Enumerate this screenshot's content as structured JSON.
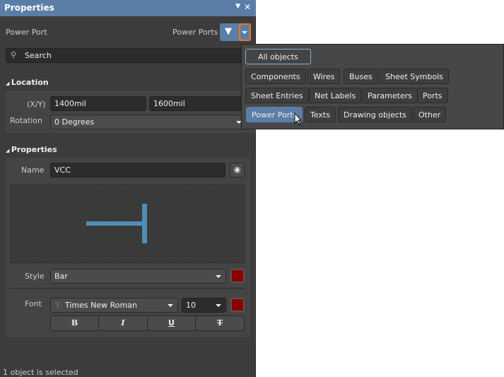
{
  "title": "Properties",
  "header": {
    "object_type": "Power Port",
    "filter_label": "Power Ports"
  },
  "search": {
    "placeholder": "Search"
  },
  "location": {
    "heading": "Location",
    "xy_label": "(X/Y)",
    "x": "1400mil",
    "y": "1600mil",
    "rotation_label": "Rotation",
    "rotation": "0 Degrees"
  },
  "properties": {
    "heading": "Properties",
    "name_label": "Name",
    "name": "VCC",
    "style_label": "Style",
    "style": "Bar",
    "font_label": "Font",
    "font": "Times New Roman",
    "font_size": "10",
    "bold": "B",
    "italic": "I",
    "underline": "U",
    "strike": "T"
  },
  "colors": {
    "accent": "#5b7ea6",
    "symbol": "#4d8fb5",
    "swatch": "#8b0000",
    "highlight": "#e87722"
  },
  "status": "1 object is selected",
  "filter_popup": {
    "all": "All objects",
    "items": [
      "Components",
      "Wires",
      "Buses",
      "Sheet Symbols",
      "Sheet Entries",
      "Net Labels",
      "Parameters",
      "Ports",
      "Power Ports",
      "Texts",
      "Drawing objects",
      "Other"
    ],
    "selected": "Power Ports"
  }
}
